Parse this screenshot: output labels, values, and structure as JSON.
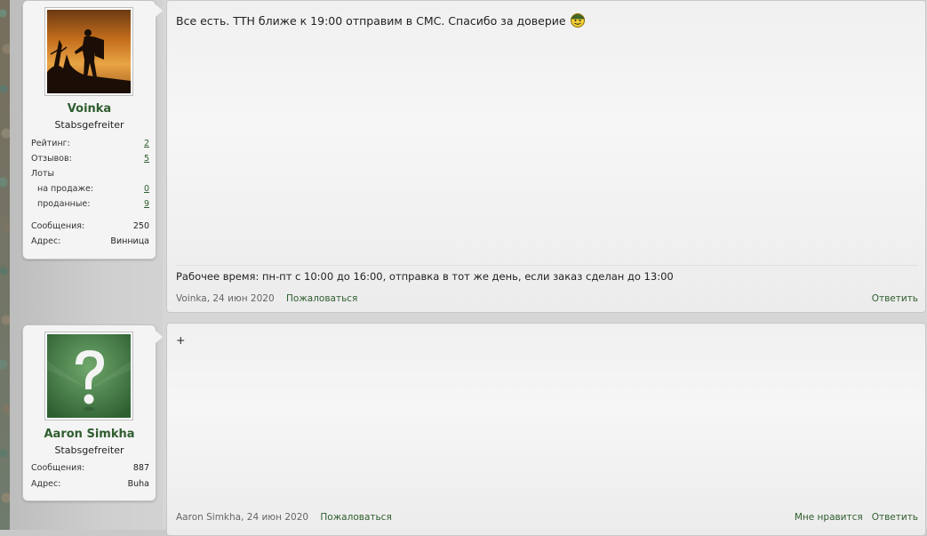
{
  "posts": [
    {
      "user": {
        "name": "Voinka",
        "rank": "Stabsgefreiter",
        "stats": {
          "rating_label": "Рейтинг:",
          "rating_value": "2",
          "reviews_label": "Отзывов:",
          "reviews_value": "5",
          "lots_label": "Лоты",
          "on_sale_label": "на продаже:",
          "on_sale_value": "0",
          "sold_label": "проданные:",
          "sold_value": "9",
          "messages_label": "Сообщения:",
          "messages_value": "250",
          "address_label": "Адрес:",
          "address_value": "Винница"
        }
      },
      "message": "Все есть. ТТН ближе к 19:00 отправим в СМС. Спасибо за доверие",
      "signature": "Рабочее время: пн-пт с 10:00 до 16:00, отправка в тот же день, если заказ сделан до 13:00",
      "meta": {
        "author_date": "Voinka, 24 июн 2020",
        "report_label": "Пожаловаться"
      },
      "actions": {
        "reply_label": "Ответить"
      }
    },
    {
      "user": {
        "name": "Aaron Simkha",
        "rank": "Stabsgefreiter",
        "stats": {
          "messages_label": "Сообщения:",
          "messages_value": "887",
          "address_label": "Адрес:",
          "address_value": "Buha"
        }
      },
      "message": "+",
      "meta": {
        "author_date": "Aaron Simkha, 24 июн 2020",
        "report_label": "Пожаловаться"
      },
      "actions": {
        "like_label": "Мне нравится",
        "reply_label": "Ответить"
      }
    }
  ],
  "colors": {
    "link": "#2f5d2f",
    "panel": "#f4f4f4",
    "background": "#d6d6d6"
  },
  "icons": {
    "smiley": "smiley-icon",
    "default_avatar": "question-mark-icon"
  }
}
